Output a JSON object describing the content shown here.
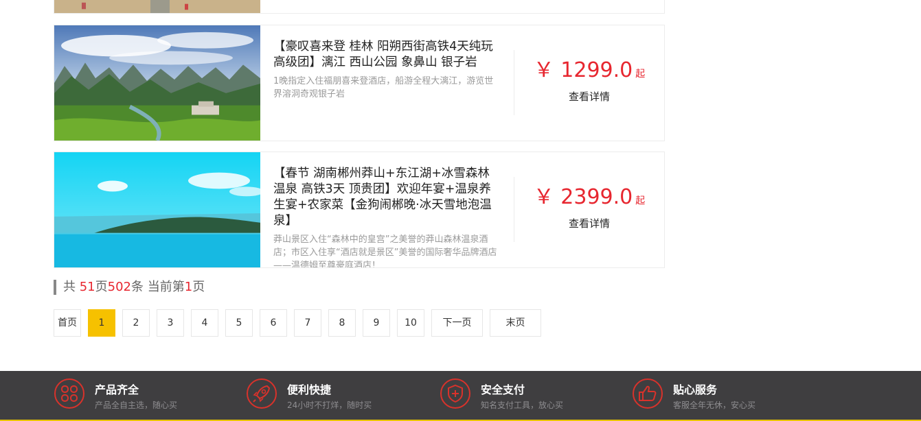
{
  "listings": [
    {
      "title": "【豪叹喜来登 桂林 阳朔西街高铁4天纯玩高级团】漓江 西山公园 象鼻山 银子岩",
      "desc": "1晚指定入住福朋喜来登酒店，船游全程大漓江，游览世界溶洞奇观银子岩",
      "price": "￥ 1299.0",
      "price_suffix": "起",
      "detail_label": "查看详情"
    },
    {
      "title": "【春节 湖南郴州莽山+东江湖+冰雪森林温泉 高铁3天 顶贵团】欢迎年宴+温泉养生宴+农家菜【金狗闹郴晚·冰天雪地泡温泉】",
      "desc": "莽山景区入住“森林中的皇宫”之美誉的莽山森林温泉酒店；市区入住享“酒店就是景区”美誉的国际奢华品牌酒店——温德姆至尊豪庭酒店！",
      "price": "￥ 2399.0",
      "price_suffix": "起",
      "detail_label": "查看详情"
    }
  ],
  "pagination": {
    "prefix": "共 ",
    "total_pages": "51",
    "pages_unit": "页",
    "total_items": "502",
    "items_unit": "条 当前第",
    "current": "1",
    "suffix": "页",
    "first_label": "首页",
    "pages": [
      "1",
      "2",
      "3",
      "4",
      "5",
      "6",
      "7",
      "8",
      "9",
      "10"
    ],
    "next_label": "下一页",
    "last_label": "末页"
  },
  "footer": {
    "features": [
      {
        "title": "产品齐全",
        "subtitle": "产品全自主选，随心买",
        "icon": "grid-icon"
      },
      {
        "title": "便利快捷",
        "subtitle": "24小时不打烊，随时买",
        "icon": "rocket-icon"
      },
      {
        "title": "安全支付",
        "subtitle": "知名支付工具，放心买",
        "icon": "shield-icon"
      },
      {
        "title": "贴心服务",
        "subtitle": "客服全年无休，安心买",
        "icon": "thumbs-up-icon"
      }
    ]
  },
  "colors": {
    "price": "#e7262f",
    "active_page": "#f6c100",
    "footer_bg": "#3f3e40",
    "footer_accent": "#e8c400",
    "icon_red": "#d9322b"
  }
}
